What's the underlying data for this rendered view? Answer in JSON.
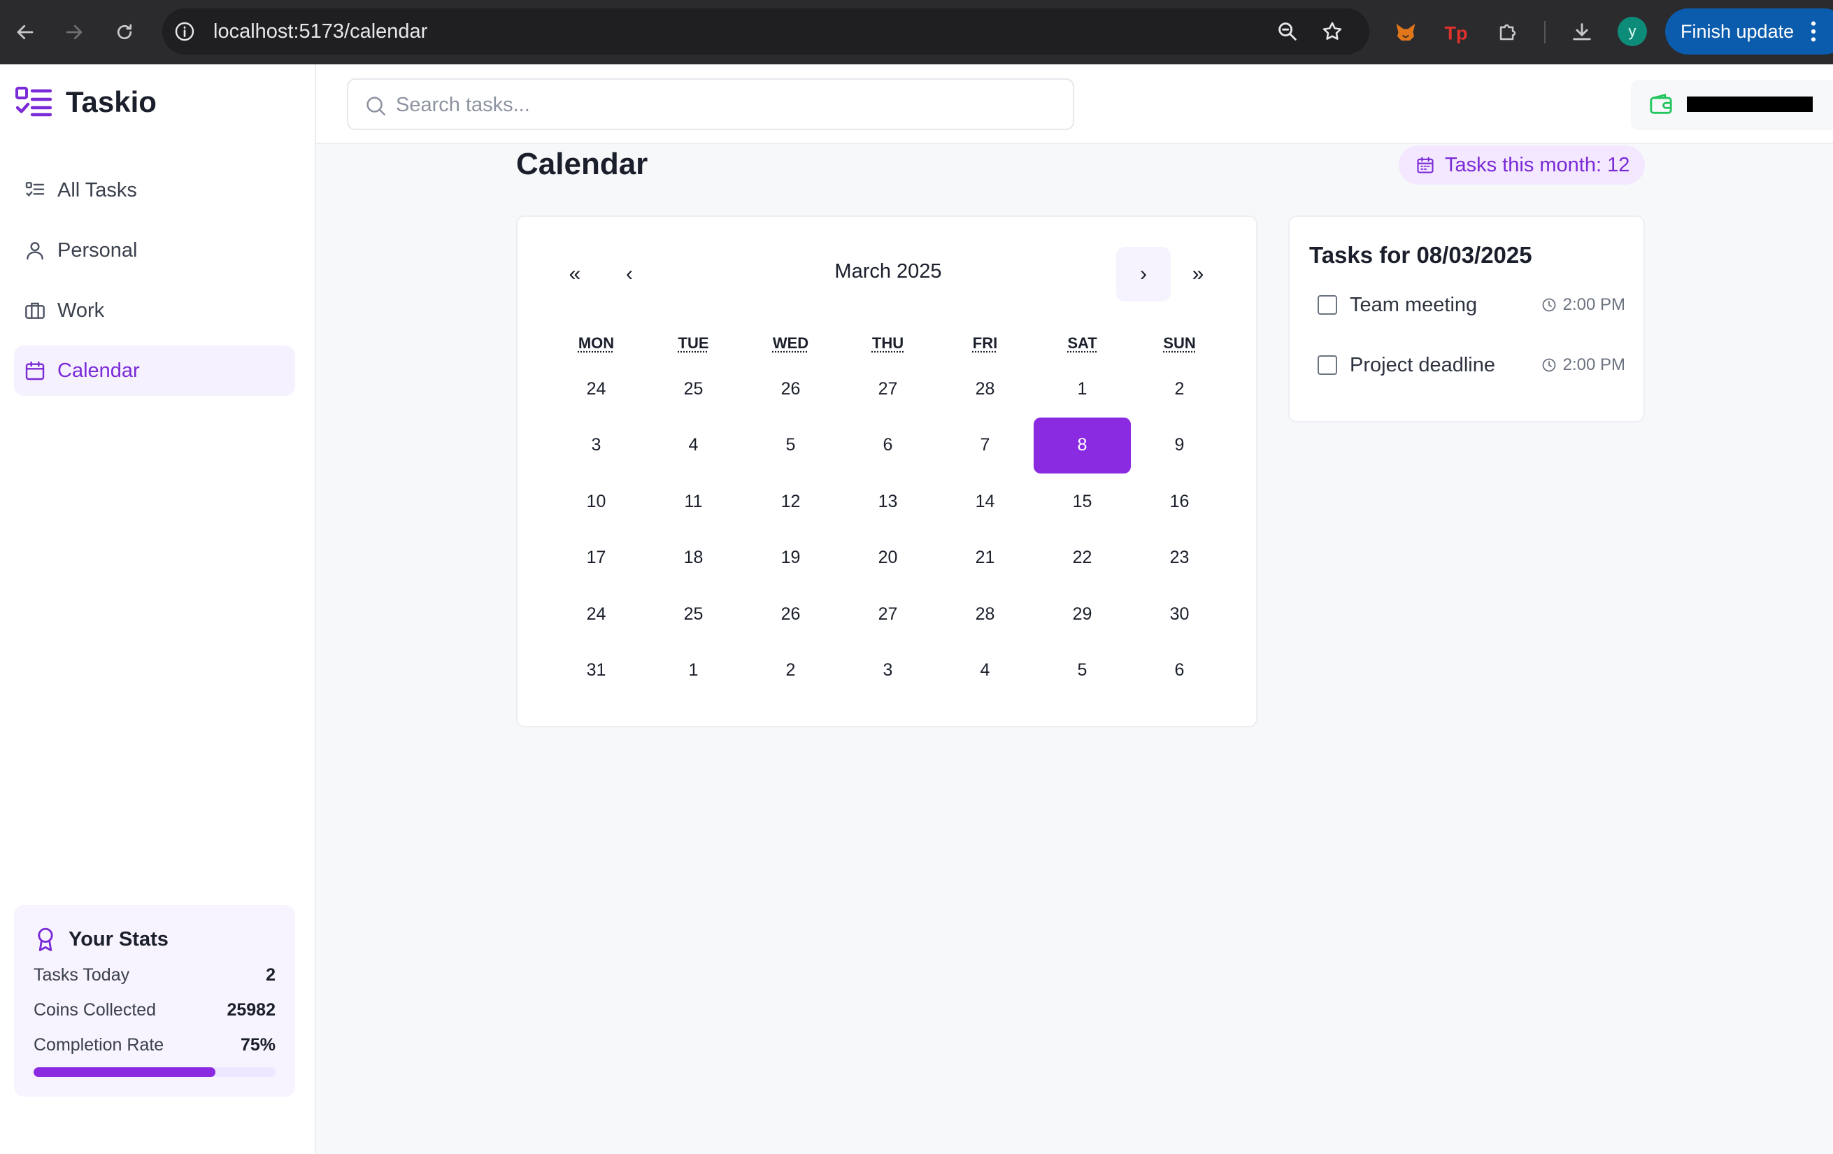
{
  "browser": {
    "url": "localhost:5173/calendar",
    "profile_initial": "y",
    "finish_update_label": "Finish update"
  },
  "sidebar": {
    "app_name": "Taskio",
    "items": [
      {
        "label": "All Tasks",
        "icon": "list-checks-icon"
      },
      {
        "label": "Personal",
        "icon": "user-icon"
      },
      {
        "label": "Work",
        "icon": "briefcase-icon"
      },
      {
        "label": "Calendar",
        "icon": "calendar-icon",
        "active": true
      }
    ],
    "stats": {
      "title": "Your Stats",
      "tasks_today_label": "Tasks Today",
      "tasks_today_value": "2",
      "coins_label": "Coins Collected",
      "coins_value": "25982",
      "completion_label": "Completion Rate",
      "completion_value": "75%",
      "completion_fraction": 0.75
    }
  },
  "header": {
    "search_placeholder": "Search tasks..."
  },
  "main": {
    "title": "Calendar",
    "month_badge": "Tasks this month: 12"
  },
  "calendar": {
    "month_label": "March 2025",
    "nav": {
      "prev_year": "«",
      "prev_month": "‹",
      "next_month": "›",
      "next_year": "»"
    },
    "weekdays": [
      "MON",
      "TUE",
      "WED",
      "THU",
      "FRI",
      "SAT",
      "SUN"
    ],
    "weeks": [
      [
        "24",
        "25",
        "26",
        "27",
        "28",
        "1",
        "2"
      ],
      [
        "3",
        "4",
        "5",
        "6",
        "7",
        "8",
        "9"
      ],
      [
        "10",
        "11",
        "12",
        "13",
        "14",
        "15",
        "16"
      ],
      [
        "17",
        "18",
        "19",
        "20",
        "21",
        "22",
        "23"
      ],
      [
        "24",
        "25",
        "26",
        "27",
        "28",
        "29",
        "30"
      ],
      [
        "31",
        "1",
        "2",
        "3",
        "4",
        "5",
        "6"
      ]
    ],
    "selected": {
      "week": 1,
      "day": 5
    }
  },
  "tasks_panel": {
    "title": "Tasks for 08/03/2025",
    "tasks": [
      {
        "name": "Team meeting",
        "time": "2:00 PM"
      },
      {
        "name": "Project deadline",
        "time": "2:00 PM"
      }
    ]
  },
  "colors": {
    "accent": "#8a2be2",
    "accent_text": "#7a2ad6",
    "badge_bg": "#f3e8ff",
    "wallet_green": "#22c55e"
  }
}
